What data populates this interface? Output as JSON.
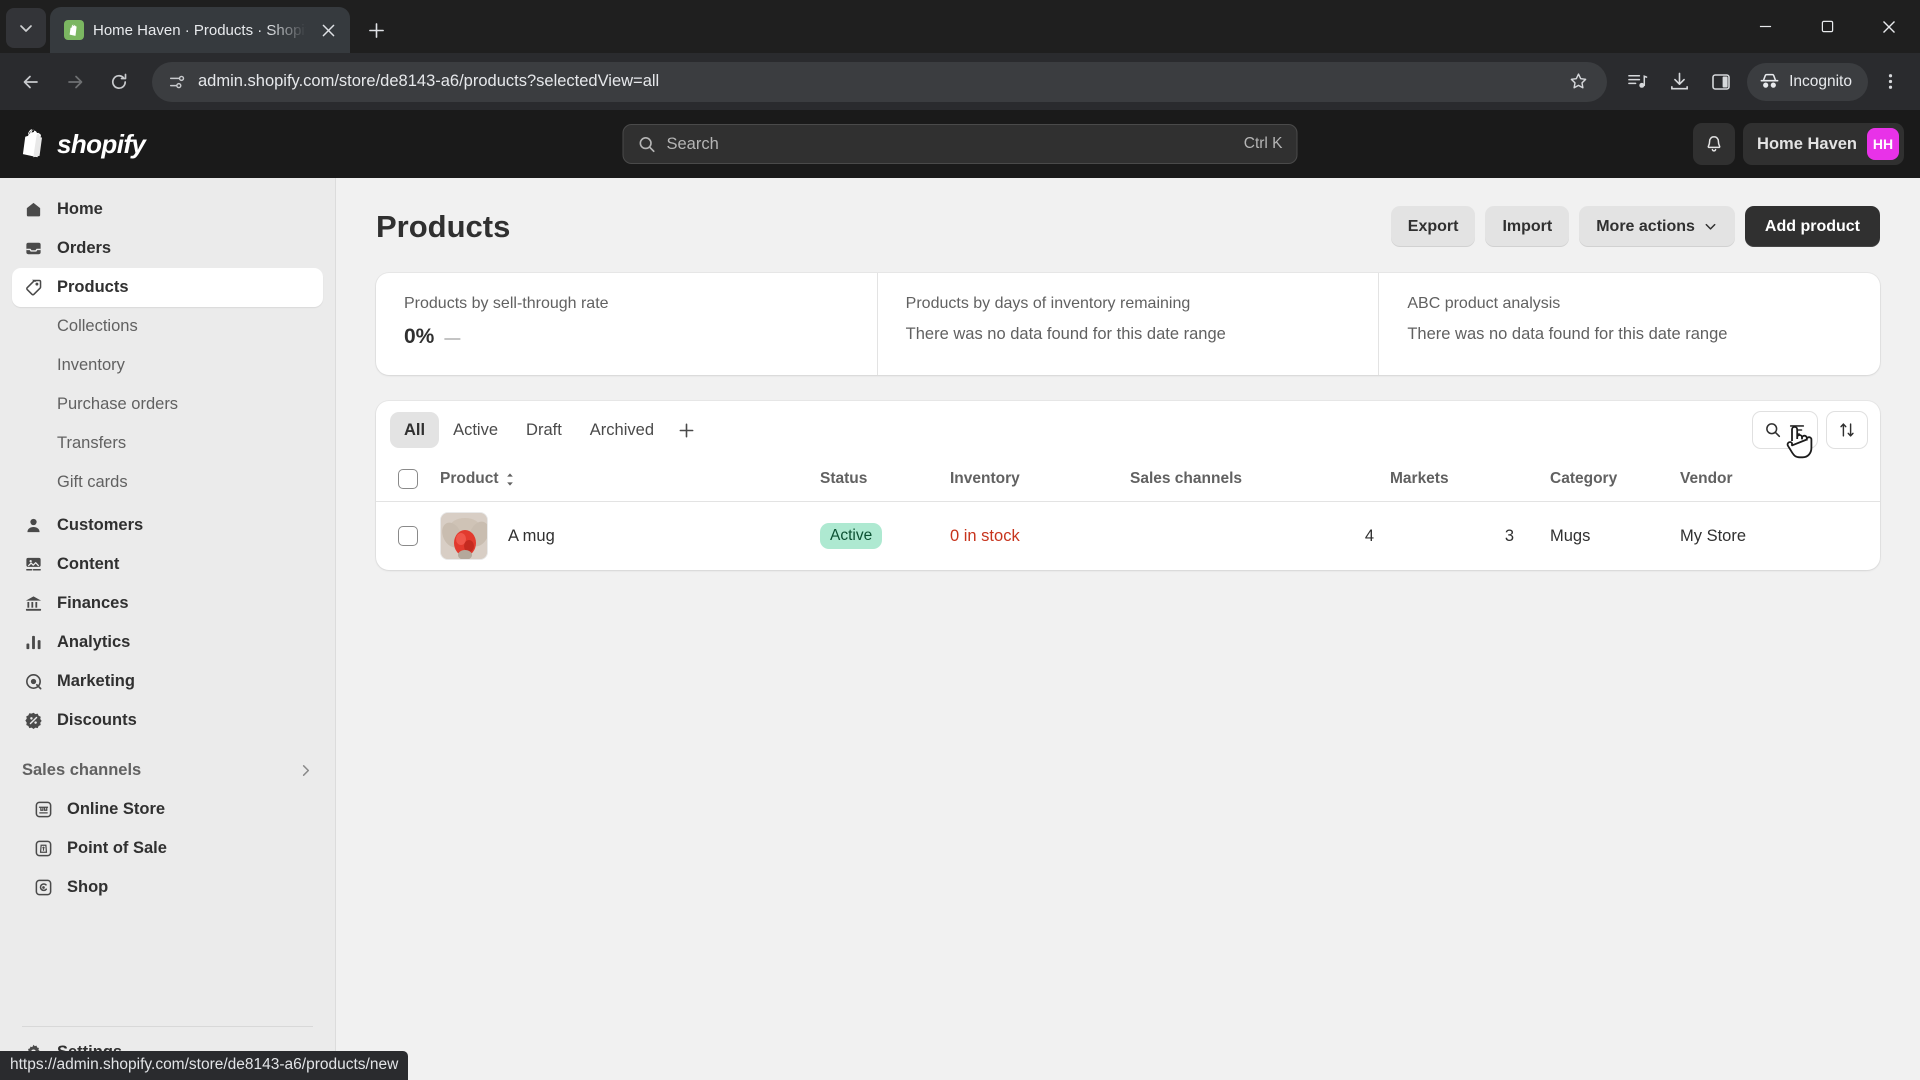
{
  "browser": {
    "tab": {
      "title": "Home Haven · Products · Shopif",
      "favicon": "shopify-bag-icon"
    },
    "new_tab_label": "+",
    "url": "admin.shopify.com/store/de8143-a6/products?selectedView=all",
    "incognito_label": "Incognito",
    "status_url": "https://admin.shopify.com/store/de8143-a6/products/new",
    "window_controls": [
      "minimize",
      "maximize",
      "close"
    ]
  },
  "topbar": {
    "logo_text": "shopify",
    "search": {
      "placeholder": "Search",
      "shortcut": "Ctrl K",
      "value": ""
    },
    "store_name": "Home Haven",
    "avatar_initials": "HH"
  },
  "sidebar": {
    "items": [
      {
        "label": "Home",
        "icon": "home-icon",
        "active": false
      },
      {
        "label": "Orders",
        "icon": "orders-inbox-icon",
        "active": false
      },
      {
        "label": "Products",
        "icon": "tag-icon",
        "active": true
      }
    ],
    "sub_items": [
      {
        "label": "Collections"
      },
      {
        "label": "Inventory"
      },
      {
        "label": "Purchase orders"
      },
      {
        "label": "Transfers"
      },
      {
        "label": "Gift cards"
      }
    ],
    "items2": [
      {
        "label": "Customers",
        "icon": "person-icon"
      },
      {
        "label": "Content",
        "icon": "content-image-icon"
      },
      {
        "label": "Finances",
        "icon": "bank-icon"
      },
      {
        "label": "Analytics",
        "icon": "bar-chart-icon"
      },
      {
        "label": "Marketing",
        "icon": "target-icon"
      },
      {
        "label": "Discounts",
        "icon": "discount-badge-icon"
      }
    ],
    "sales_channels": {
      "label": "Sales channels",
      "items": [
        {
          "label": "Online Store",
          "icon": "storefront-icon"
        },
        {
          "label": "Point of Sale",
          "icon": "pos-icon"
        },
        {
          "label": "Shop",
          "icon": "shop-icon"
        }
      ]
    },
    "settings": {
      "label": "Settings",
      "icon": "gear-icon"
    }
  },
  "page": {
    "title": "Products",
    "actions": {
      "export": "Export",
      "import": "Import",
      "more_actions": "More actions",
      "add_product": "Add product"
    }
  },
  "metrics": [
    {
      "label": "Products by sell-through rate",
      "value": "0%",
      "trend": "—",
      "empty": ""
    },
    {
      "label": "Products by days of inventory remaining",
      "value": "",
      "trend": "",
      "empty": "There was no data found for this date range"
    },
    {
      "label": "ABC product analysis",
      "value": "",
      "trend": "",
      "empty": "There was no data found for this date range"
    }
  ],
  "table": {
    "tabs": [
      {
        "label": "All",
        "selected": true
      },
      {
        "label": "Active",
        "selected": false
      },
      {
        "label": "Draft",
        "selected": false
      },
      {
        "label": "Archived",
        "selected": false
      }
    ],
    "add_view_label": "+",
    "columns": [
      "Product",
      "Status",
      "Inventory",
      "Sales channels",
      "Markets",
      "Category",
      "Vendor"
    ],
    "rows": [
      {
        "product": "A mug",
        "status": "Active",
        "inventory": "0 in stock",
        "sales_channels": "4",
        "markets": "3",
        "category": "Mugs",
        "vendor": "My Store"
      }
    ]
  },
  "colors": {
    "accent_dark": "#303030",
    "avatar_magenta": "#e832e8",
    "badge_success_bg": "#aee9d1",
    "badge_success_text": "#0c5132",
    "stock_warning": "#c7341d"
  }
}
